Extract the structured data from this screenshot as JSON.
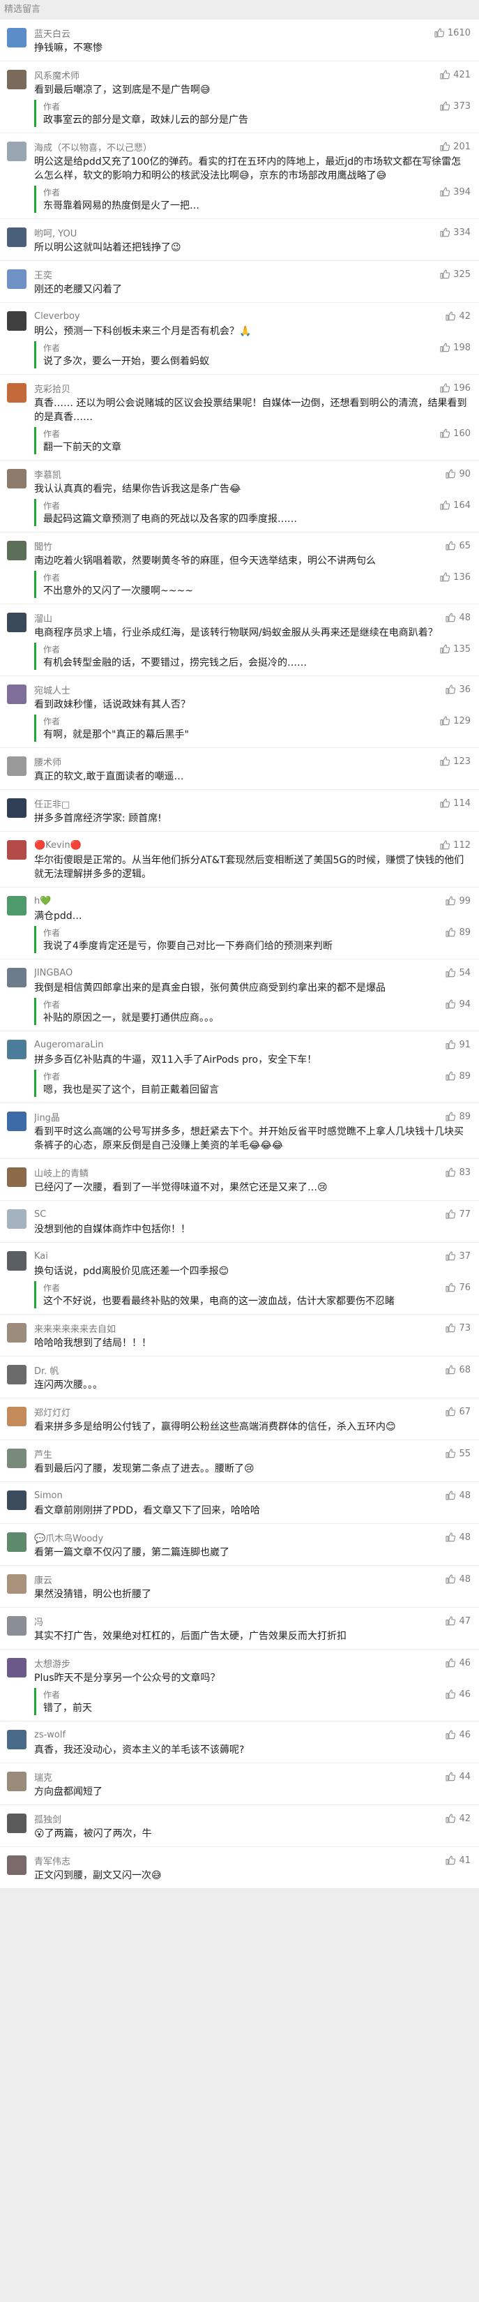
{
  "header": {
    "title": "精选留言"
  },
  "reply_label": "作者",
  "comments": [
    {
      "nick": "蓝天白云",
      "likes": "1610",
      "color": "#5b8ec9",
      "text": "挣钱嘛，不寒惨",
      "reply": null
    },
    {
      "nick": "风系魔术师",
      "likes": "421",
      "color": "#7a6a5c",
      "text": "看到最后嘲凉了，这到底是不是广告啊😅",
      "reply": {
        "likes": "373",
        "text": "政事室云的部分是文章，政妹儿云的部分是广告"
      }
    },
    {
      "nick": "海成（不以物喜，不以己悲）",
      "likes": "201",
      "color": "#9aa7b2",
      "text": "明公这是给pdd又充了100亿的弹药。看实的打在五环内的阵地上，最近jd的市场软文都在写徐雷怎么怎么样，软文的影响力和明公的核武没法比啊😅，京东的市场部改用鹰战略了😅",
      "reply": {
        "likes": "394",
        "text": "东哥靠着网易的热度倒是火了一把…"
      }
    },
    {
      "nick": "哟呵, YOU",
      "likes": "334",
      "color": "#4a5f78",
      "text": "所以明公这就叫站着还把钱挣了😉",
      "reply": null
    },
    {
      "nick": "王奕",
      "likes": "325",
      "color": "#6f93c4",
      "text": "刚还的老腰又闪着了",
      "reply": null
    },
    {
      "nick": "Cleverboy",
      "likes": "42",
      "color": "#3f3f3f",
      "text": "明公，预测一下科创板未来三个月是否有机会？🙏",
      "reply": {
        "likes": "198",
        "text": "说了多次，要么一开始，要么倒着蚂蚁"
      }
    },
    {
      "nick": "克彩拾贝",
      "likes": "196",
      "color": "#c46a3a",
      "text": "真香……\n还以为明公会说赌城的区议会投票结果呢！自媒体一边倒，还想看到明公的清流，结果看到的是真香……",
      "reply": {
        "likes": "160",
        "text": "翻一下前天的文章"
      }
    },
    {
      "nick": "李慕凯",
      "likes": "90",
      "color": "#8c7b6a",
      "text": "我认认真真的看完，结果你告诉我这是条广告😂",
      "reply": {
        "likes": "164",
        "text": "最起码这篇文章预测了电商的死战以及各家的四季度报……"
      }
    },
    {
      "nick": "聞竹",
      "likes": "65",
      "color": "#5d6f58",
      "text": "南边吃着火锅唱着歌，然要喇黄冬爷的麻匪，但今天选举结束，明公不讲两句么",
      "reply": {
        "likes": "136",
        "text": "不出意外的又闪了一次腰啊~~~~"
      }
    },
    {
      "nick": "溜山",
      "likes": "48",
      "color": "#3a4a5a",
      "text": "电商程序员求上墙，行业杀成红海，是该转行物联网/蚂蚁金服从头再来还是继续在电商趴着？",
      "reply": {
        "likes": "135",
        "text": "有机会转型金融的话，不要错过，捞完钱之后，会挺冷的……"
      }
    },
    {
      "nick": "宛城人士",
      "likes": "36",
      "color": "#7d6e9a",
      "text": "看到政妹秒懂，话说政妹有其人否？",
      "reply": {
        "likes": "129",
        "text": "有啊，就是那个\"真正的幕后黑手\""
      }
    },
    {
      "nick": "腰术师",
      "likes": "123",
      "color": "#9a9a9a",
      "text": "真正的软文,敢于直面读者的嘲遥…",
      "reply": null
    },
    {
      "nick": "任正非□",
      "likes": "114",
      "color": "#2f3e55",
      "text": "拼多多首席经济学家: 顾首席!",
      "reply": null
    },
    {
      "nick": "🔴Kevin🔴",
      "likes": "112",
      "color": "#b44a4a",
      "text": "华尔街傻眼是正常的。从当年他们拆分AT&T套现然后变相断送了美国5G的时候，赚惯了快钱的他们就无法理解拼多多的逻辑。",
      "reply": null
    },
    {
      "nick": "h💚",
      "likes": "99",
      "color": "#4f9a6a",
      "text": "满仓pdd…",
      "reply": {
        "likes": "89",
        "text": "我说了4季度肯定还是亏，你要自己对比一下券商们给的预测来判断"
      }
    },
    {
      "nick": "JINGBAO",
      "likes": "54",
      "color": "#6c7c8a",
      "text": "我倒是相信黄四郎拿出来的是真金白银，张何黄供应商受到约拿出来的都不是爆品",
      "reply": {
        "likes": "94",
        "text": "补贴的原因之一，就是要打通供应商。。。"
      }
    },
    {
      "nick": "AugeromaraLin",
      "likes": "91",
      "color": "#4d7c9a",
      "text": "拼多多百亿补贴真的牛逼，双11入手了AirPods pro，安全下车！",
      "reply": {
        "likes": "89",
        "text": "嗯，我也是买了这个，目前正戴着回留言"
      }
    },
    {
      "nick": "Jing晶",
      "likes": "89",
      "color": "#3d6ba8",
      "text": "看到平时这么高端的公号写拼多多，想赶紧去下个。并开始反省平时感觉瞧不上拿人几块钱十几块买条裤子的心态，原来反倒是自己没赚上美资的羊毛😂😂😂",
      "reply": null
    },
    {
      "nick": "山岐上的青鳞",
      "likes": "83",
      "color": "#8a6a48",
      "text": "已经闪了一次腰，看到了一半觉得味道不对，果然它还是又来了…😢",
      "reply": null
    },
    {
      "nick": "SC",
      "likes": "77",
      "color": "#a5b2bf",
      "text": "没想到他的自媒体商炸中包括你！！",
      "reply": null
    },
    {
      "nick": "Kai",
      "likes": "37",
      "color": "#5a5f64",
      "text": "换句话说，pdd离股价见底还差一个四季报😊",
      "reply": {
        "likes": "76",
        "text": "这个不好说，也要看最终补贴的效果，电商的这一波血战，估计大家都要伤不忍睹"
      }
    },
    {
      "nick": "来来来来来来去自如",
      "likes": "73",
      "color": "#9b8c7d",
      "text": "哈哈哈我想到了结局！！！",
      "reply": null
    },
    {
      "nick": "Dr. 帆",
      "likes": "68",
      "color": "#6b6b6b",
      "text": "连闪两次腰。。。",
      "reply": null
    },
    {
      "nick": "郑灯灯灯",
      "likes": "67",
      "color": "#c48a5a",
      "text": "看来拼多多是给明公付钱了，赢得明公粉丝这些高端消费群体的信任，杀入五环内😊",
      "reply": null
    },
    {
      "nick": "芦生",
      "likes": "55",
      "color": "#7a8a7a",
      "text": "看到最后闪了腰，发现第二条点了进去。。腰断了😢",
      "reply": null
    },
    {
      "nick": "Simon",
      "likes": "48",
      "color": "#3c4c5c",
      "text": "看文章前刚刚拼了PDD，看文章又下了回来，哈哈哈",
      "reply": null
    },
    {
      "nick": "💬爪木鸟Woody",
      "likes": "48",
      "color": "#5c8a6a",
      "text": "看第一篇文章不仅闪了腰，第二篇连脚也崴了",
      "reply": null
    },
    {
      "nick": "康云",
      "likes": "48",
      "color": "#a8927c",
      "text": "果然没猜错，明公也折腰了",
      "reply": null
    },
    {
      "nick": "冯",
      "likes": "47",
      "color": "#8a8f95",
      "text": "其实不打广告，效果绝对杠杠的，后面广告太硬，广告效果反而大打折扣",
      "reply": null
    },
    {
      "nick": "太想游步",
      "likes": "46",
      "color": "#6a5a8a",
      "text": "Plus昨天不是分享另一个公众号的文章吗？",
      "reply": {
        "likes": "46",
        "text": "错了，前天"
      }
    },
    {
      "nick": "zs-wolf",
      "likes": "46",
      "color": "#4a6a8a",
      "text": "真香，我还没动心，资本主义的羊毛该不该薅呢?",
      "reply": null
    },
    {
      "nick": "瑞克",
      "likes": "44",
      "color": "#9a8a7a",
      "text": "方向盘都闻短了",
      "reply": null
    },
    {
      "nick": "孤独剑",
      "likes": "42",
      "color": "#5a5a5a",
      "text": "😮了两篇，被闪了两次，牛",
      "reply": null
    },
    {
      "nick": "青军伟志",
      "likes": "41",
      "color": "#7a6a6a",
      "text": "正文闪到腰，副文又闪一次😅",
      "reply": null
    }
  ]
}
